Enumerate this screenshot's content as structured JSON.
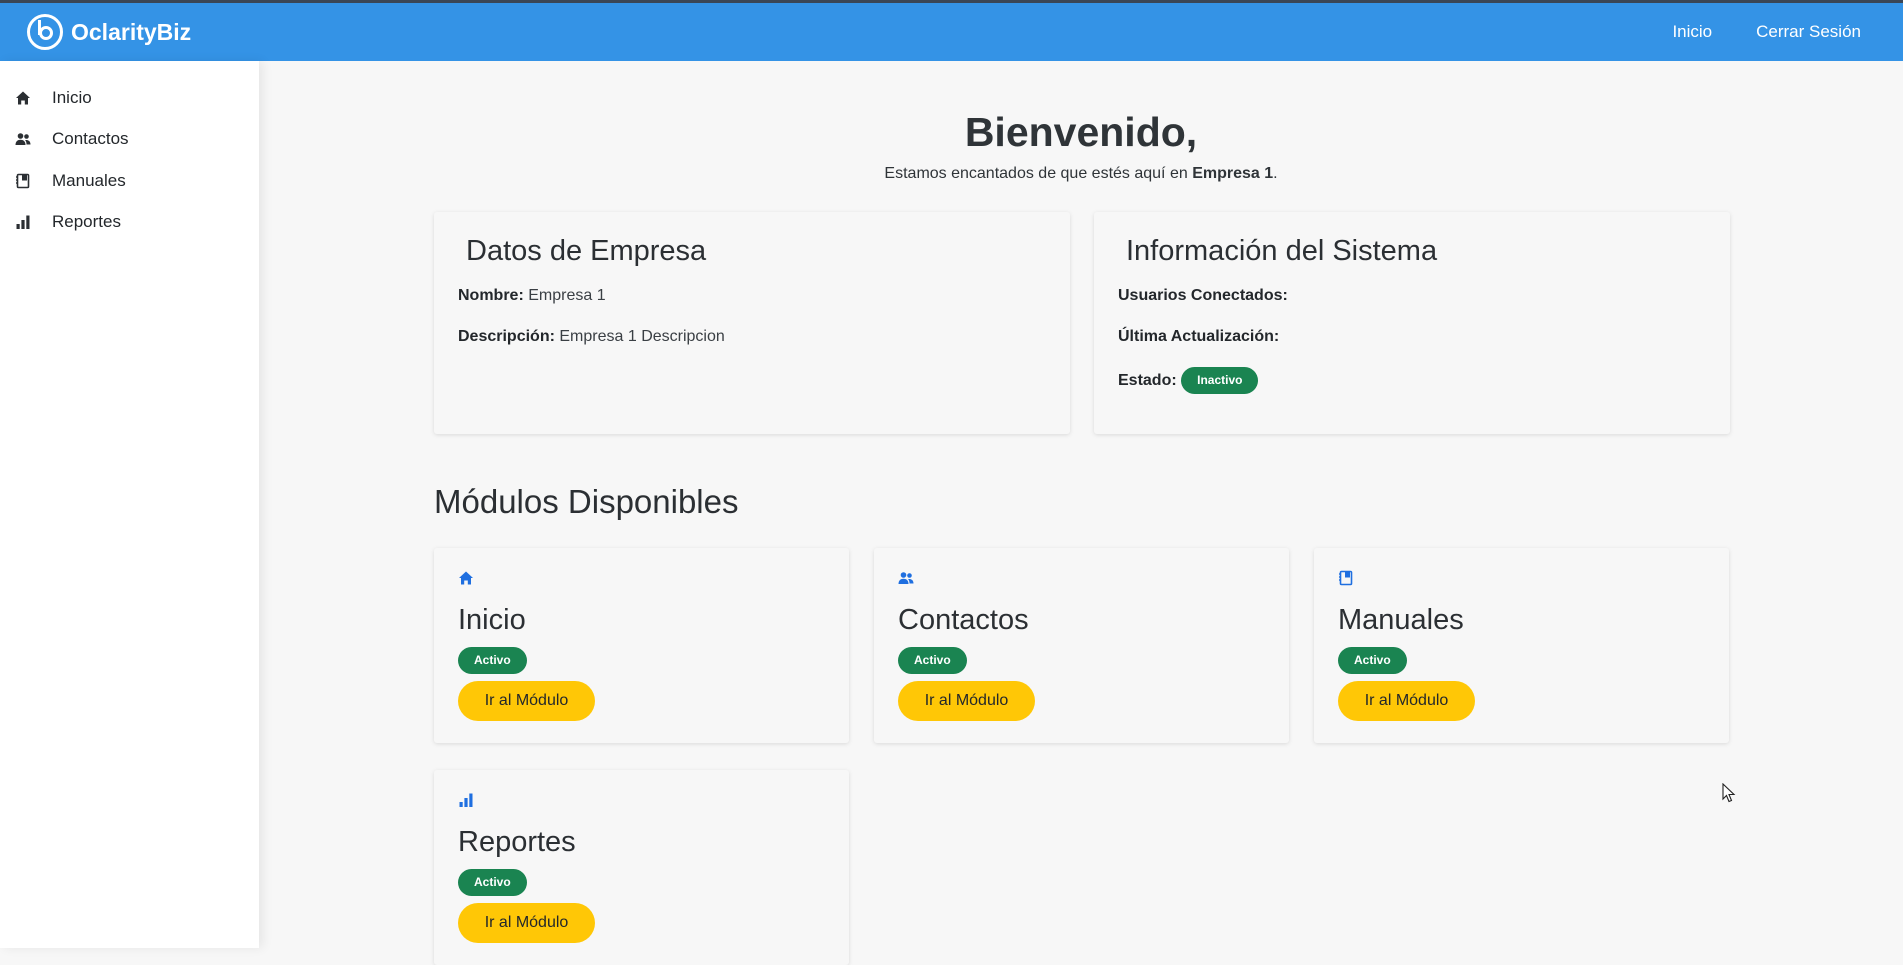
{
  "navbar": {
    "brand": "OclarityBiz",
    "links": [
      "Inicio",
      "Cerrar Sesión"
    ]
  },
  "sidebar": {
    "items": [
      {
        "label": "Inicio",
        "icon": "home-icon"
      },
      {
        "label": "Contactos",
        "icon": "users-icon"
      },
      {
        "label": "Manuales",
        "icon": "book-icon"
      },
      {
        "label": "Reportes",
        "icon": "chart-bar-icon"
      }
    ]
  },
  "welcome": {
    "title": "Bienvenido,",
    "subtitle_prefix": "Estamos encantados de que estés aquí en ",
    "company": "Empresa 1",
    "subtitle_suffix": "."
  },
  "company_card": {
    "title": "Datos de Empresa",
    "name_label": "Nombre:",
    "name_value": "Empresa 1",
    "desc_label": "Descripción:",
    "desc_value": "Empresa 1 Descripcion"
  },
  "system_card": {
    "title": "Información del Sistema",
    "users_label": "Usuarios Conectados:",
    "updated_label": "Última Actualización:",
    "status_label": "Estado:",
    "status_value": "Inactivo"
  },
  "modules": {
    "title": "Módulos Disponibles",
    "items": [
      {
        "name": "Inicio",
        "status": "Activo",
        "button": "Ir al Módulo",
        "icon": "home-icon"
      },
      {
        "name": "Contactos",
        "status": "Activo",
        "button": "Ir al Módulo",
        "icon": "users-icon"
      },
      {
        "name": "Manuales",
        "status": "Activo",
        "button": "Ir al Módulo",
        "icon": "book-icon"
      },
      {
        "name": "Reportes",
        "status": "Activo",
        "button": "Ir al Módulo",
        "icon": "chart-bar-icon"
      }
    ]
  },
  "colors": {
    "navbar": "#3493e6",
    "badge_green": "#1a8451",
    "button_yellow": "#ffc706",
    "module_icon_blue": "#1f6fe0"
  }
}
